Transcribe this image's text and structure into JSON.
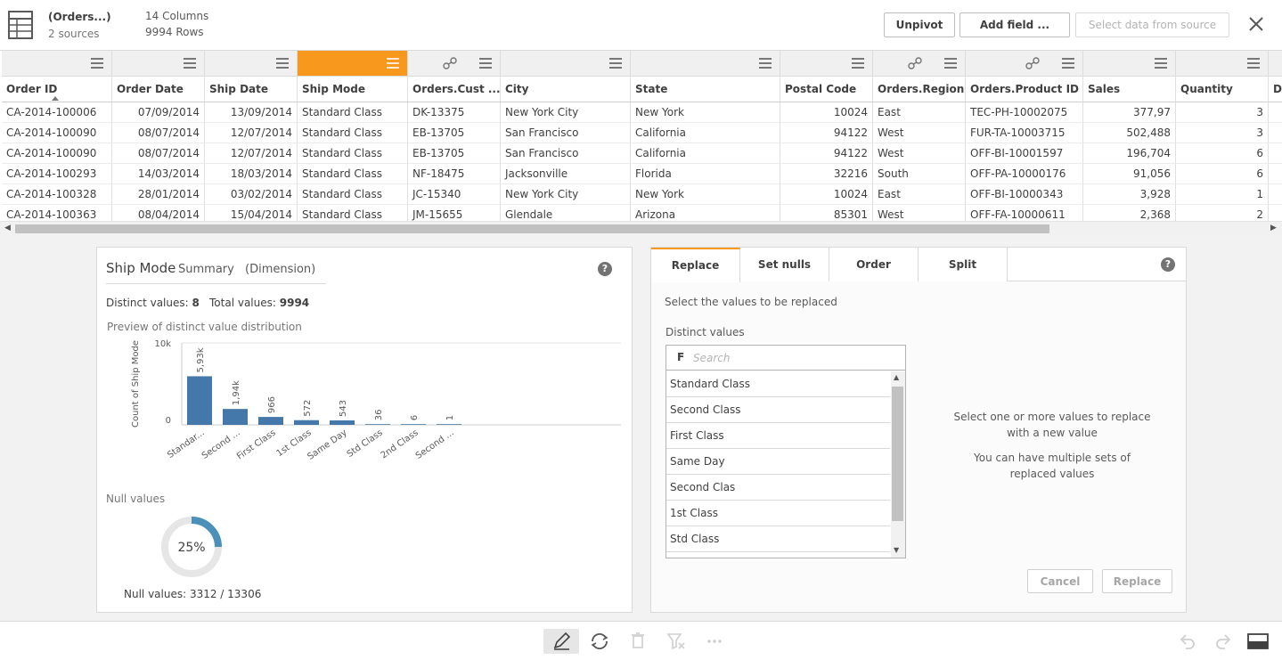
{
  "header": {
    "title": "(Orders...)",
    "sources": "2 sources",
    "columns": "14 Columns",
    "rows": "9994 Rows",
    "unpivot": "Unpivot",
    "add_field": "Add field  ...",
    "select_data": "Select data from source"
  },
  "table": {
    "columns": [
      "Order ID",
      "Order Date",
      "Ship Date",
      "Ship Mode",
      "Orders.Cust ...",
      "City",
      "State",
      "Postal Code",
      "Orders.Region",
      "Orders.Product ID",
      "Sales",
      "Quantity",
      "D"
    ],
    "rows": [
      [
        "CA-2014-100006",
        "07/09/2014",
        "13/09/2014",
        "Standard Class",
        "DK-13375",
        "New York City",
        "New York",
        "10024",
        "East",
        "TEC-PH-10002075",
        "377,97",
        "3"
      ],
      [
        "CA-2014-100090",
        "08/07/2014",
        "12/07/2014",
        "Standard Class",
        "EB-13705",
        "San Francisco",
        "California",
        "94122",
        "West",
        "FUR-TA-10003715",
        "502,488",
        "3"
      ],
      [
        "CA-2014-100090",
        "08/07/2014",
        "12/07/2014",
        "Standard Class",
        "EB-13705",
        "San Francisco",
        "California",
        "94122",
        "West",
        "OFF-BI-10001597",
        "196,704",
        "6"
      ],
      [
        "CA-2014-100293",
        "14/03/2014",
        "18/03/2014",
        "Standard Class",
        "NF-18475",
        "Jacksonville",
        "Florida",
        "32216",
        "South",
        "OFF-PA-10000176",
        "91,056",
        "6"
      ],
      [
        "CA-2014-100328",
        "28/01/2014",
        "03/02/2014",
        "Standard Class",
        "JC-15340",
        "New York City",
        "New York",
        "10024",
        "East",
        "OFF-BI-10000343",
        "3,928",
        "1"
      ],
      [
        "CA-2014-100363",
        "08/04/2014",
        "15/04/2014",
        "Standard Class",
        "JM-15655",
        "Glendale",
        "Arizona",
        "85301",
        "West",
        "OFF-FA-10000611",
        "2,368",
        "2"
      ]
    ]
  },
  "summary": {
    "title": "Ship Mode",
    "subtitle": "Summary",
    "dimension": "(Dimension)",
    "distinct_label": "Distinct values:",
    "distinct_value": "8",
    "total_label": "Total values:",
    "total_value": "9994",
    "preview_label": "Preview of distinct value distribution",
    "null_label": "Null values",
    "null_percent": "25%",
    "null_fraction": 0.25,
    "null_values_text": "Null values: 3312 / 13306"
  },
  "chart_data": {
    "type": "bar",
    "ylabel": "Count of Ship Mode",
    "y_ticks": [
      "10k",
      "0"
    ],
    "ylim": [
      0,
      10000
    ],
    "categories": [
      "Standar...",
      "Second ...",
      "First Class",
      "1st Class",
      "Same Day",
      "Std Class",
      "2nd Class",
      "Second ..."
    ],
    "values": [
      5930,
      1940,
      966,
      572,
      543,
      36,
      6,
      1
    ],
    "data_labels": [
      "5,93k",
      "1,94k",
      "966",
      "572",
      "543",
      "36",
      "6",
      "1"
    ],
    "bar_color": "#4477aa"
  },
  "replace": {
    "tabs": [
      "Replace",
      "Set nulls",
      "Order",
      "Split"
    ],
    "select_label": "Select the values to be replaced",
    "distinct_label": "Distinct values",
    "search_prefix": "F",
    "search_placeholder": "Search",
    "values": [
      "Standard Class",
      "Second Class",
      "First Class",
      "Same Day",
      "Second Clas",
      "1st Class",
      "Std Class"
    ],
    "info1": "Select one or more values to replace with a new value",
    "info2": "You can have multiple sets of replaced values",
    "cancel": "Cancel",
    "replace_btn": "Replace"
  },
  "colors": {
    "accent": "#f8981d",
    "bar": "#4477aa",
    "donut": "#4a90b8"
  }
}
